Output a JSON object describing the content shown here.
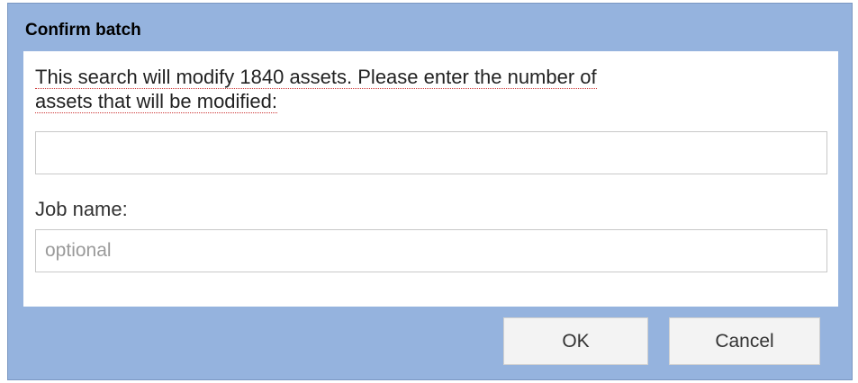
{
  "dialog": {
    "title": "Confirm batch",
    "message_line1": "This search will modify 1840 assets. Please enter the number of",
    "message_line2": "assets that will be modified:",
    "count_input": {
      "value": "",
      "placeholder": ""
    },
    "job_name_label": "Job name:",
    "job_name_input": {
      "value": "",
      "placeholder": "optional"
    },
    "buttons": {
      "ok_label": "OK",
      "cancel_label": "Cancel"
    }
  },
  "colors": {
    "frame": "#95b3de",
    "body": "#ffffff",
    "button": "#f3f3f3"
  }
}
